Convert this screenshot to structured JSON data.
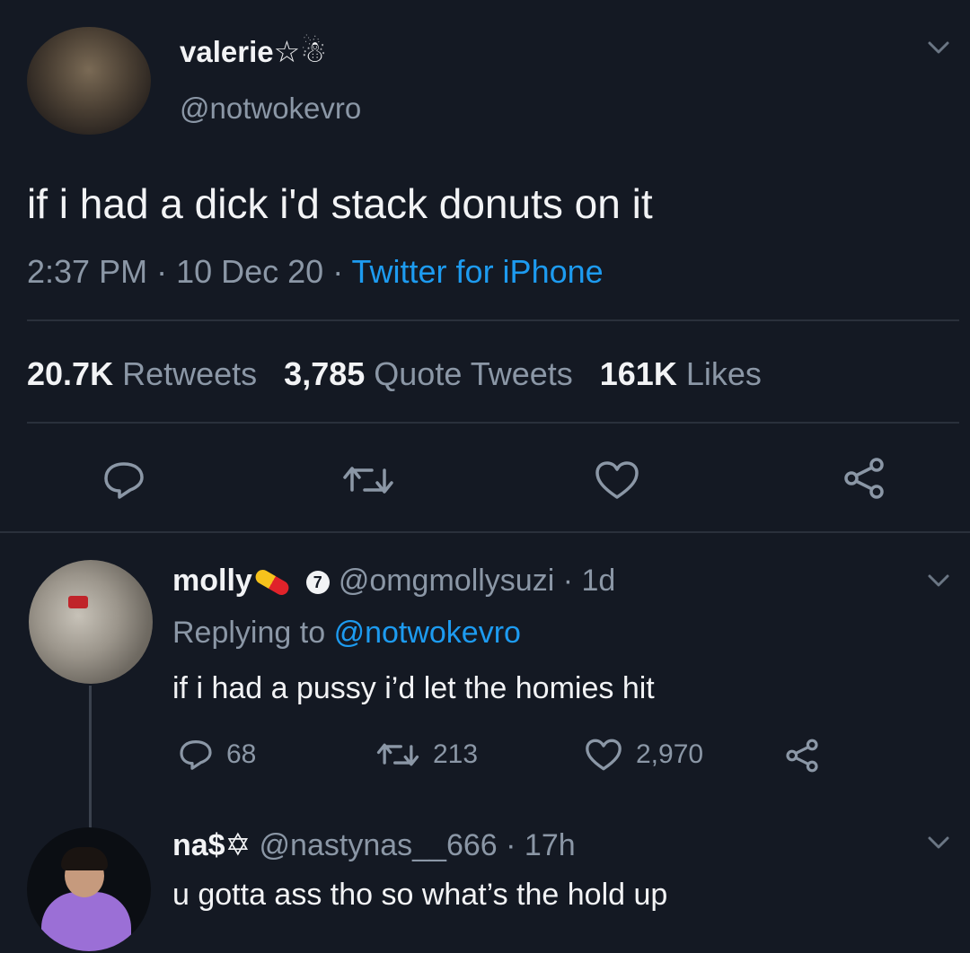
{
  "main_tweet": {
    "display_name": "valerie☆",
    "name_emoji": "☃",
    "handle": "@notwokevro",
    "text": "if i had a dick i'd stack donuts on it",
    "time": "2:37 PM",
    "date": "10 Dec 20",
    "source": "Twitter for iPhone",
    "separator": " · ",
    "stats": {
      "retweets_count": "20.7K",
      "retweets_label": "Retweets",
      "quotes_count": "3,785",
      "quotes_label": "Quote Tweets",
      "likes_count": "161K",
      "likes_label": "Likes"
    },
    "actions": [
      "reply-icon",
      "retweet-icon",
      "like-icon",
      "share-icon"
    ]
  },
  "replies": [
    {
      "display_name": "molly",
      "emoji": "pill",
      "badge": "7",
      "handle": "@omgmollysuzi",
      "age": "1d",
      "replying_prefix": "Replying to",
      "replying_to": "@notwokevro",
      "text": "if i had a pussy i’d let the homies hit",
      "replies": "68",
      "retweets": "213",
      "likes": "2,970"
    },
    {
      "display_name": "na$",
      "emoji": "✡",
      "handle": "@nastynas__666",
      "age": "17h",
      "text": "u gotta ass tho so what’s the hold up"
    }
  ],
  "colors": {
    "background": "#141923",
    "text": "#f2f3f5",
    "muted": "#8b97a6",
    "link": "#1d9bf0"
  }
}
